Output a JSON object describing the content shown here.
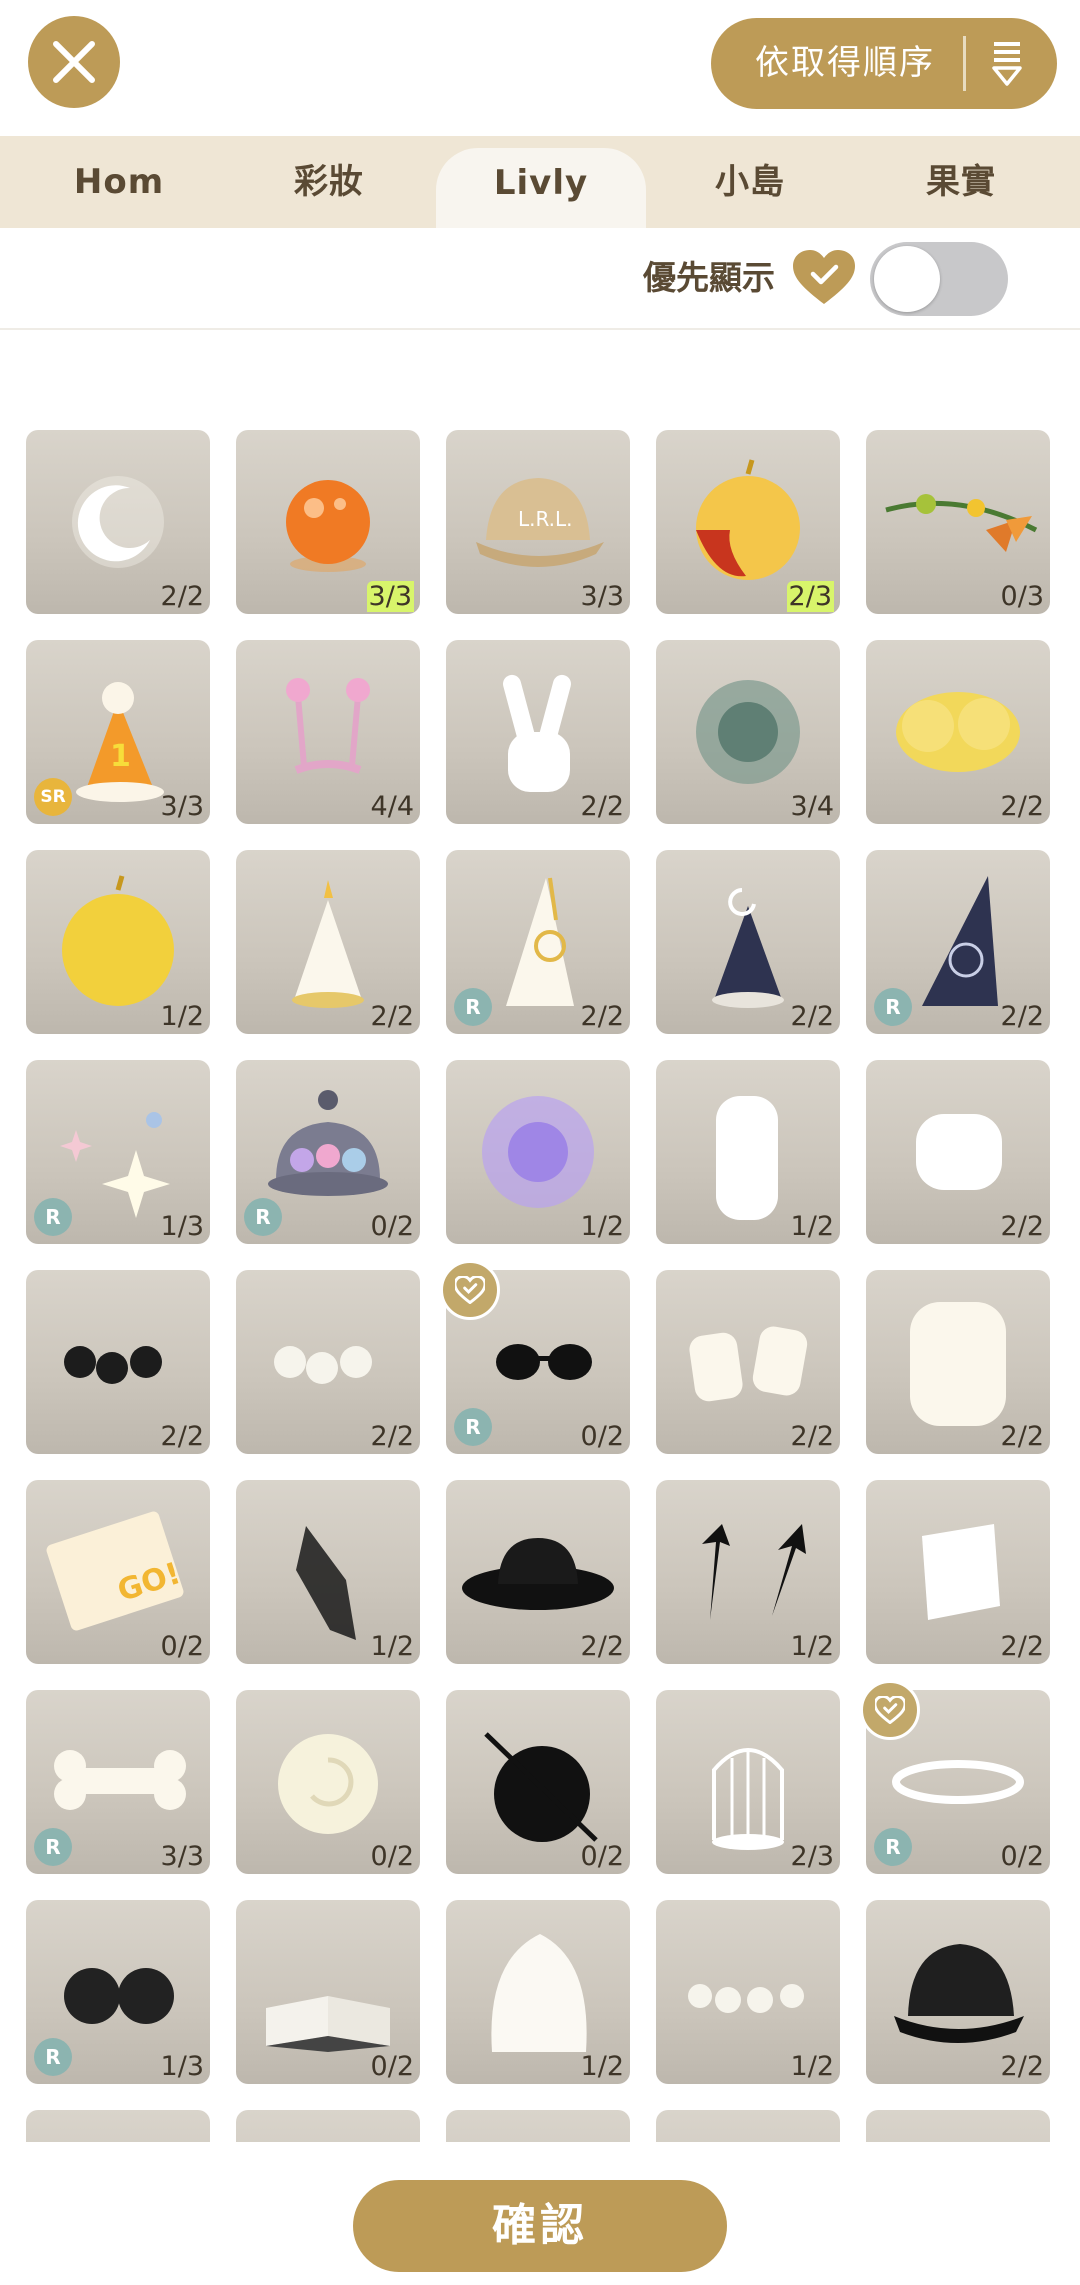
{
  "header": {
    "close_icon": "close-icon",
    "sort_label": "依取得順序",
    "sort_icon": "sort-order-icon"
  },
  "tabs": [
    {
      "label": "Hom",
      "active": false
    },
    {
      "label": "彩妝",
      "active": false
    },
    {
      "label": "Livly",
      "active": true
    },
    {
      "label": "小島",
      "active": false
    },
    {
      "label": "果實",
      "active": false
    }
  ],
  "filter": {
    "label": "優先顯示",
    "icon": "heart-check-icon",
    "toggle_on": false
  },
  "items": [
    {
      "name": "crescent-moon",
      "count": "2/2",
      "icon": "moon"
    },
    {
      "name": "orange-jelly",
      "count": "3/3",
      "icon": "orange-ball",
      "highlight": true
    },
    {
      "name": "lrl-cap",
      "count": "3/3",
      "icon": "beige-cap"
    },
    {
      "name": "candy-apple",
      "count": "2/3",
      "icon": "gold-apple",
      "highlight": true
    },
    {
      "name": "orange-flower-vine",
      "count": "0/3",
      "icon": "vine"
    },
    {
      "name": "party-hat-1",
      "count": "3/3",
      "icon": "party-hat",
      "badge": "SR"
    },
    {
      "name": "pink-star-antenna",
      "count": "4/4",
      "icon": "antenna"
    },
    {
      "name": "peace-glove",
      "count": "2/2",
      "icon": "peace-hand"
    },
    {
      "name": "green-fluff",
      "count": "3/4",
      "icon": "green-burst"
    },
    {
      "name": "gold-cloud",
      "count": "2/2",
      "icon": "gold-cloud"
    },
    {
      "name": "golden-apple",
      "count": "1/2",
      "icon": "golden-apple"
    },
    {
      "name": "white-cone-hat",
      "count": "2/2",
      "icon": "white-cone"
    },
    {
      "name": "sun-cone-hat",
      "count": "2/2",
      "icon": "white-cone-tall",
      "badge": "R"
    },
    {
      "name": "moon-cone-hat",
      "count": "2/2",
      "icon": "navy-cone"
    },
    {
      "name": "navy-tall-cone",
      "count": "2/2",
      "icon": "navy-cone-tall",
      "badge": "R"
    },
    {
      "name": "sparkles",
      "count": "1/3",
      "icon": "sparkles",
      "badge": "R"
    },
    {
      "name": "gem-dome",
      "count": "0/2",
      "icon": "dome",
      "badge": "R"
    },
    {
      "name": "purple-fluff",
      "count": "1/2",
      "icon": "purple-burst"
    },
    {
      "name": "open-glove",
      "count": "1/2",
      "icon": "open-hand"
    },
    {
      "name": "fist-glove",
      "count": "2/2",
      "icon": "fist"
    },
    {
      "name": "black-roses",
      "count": "2/2",
      "icon": "black-roses"
    },
    {
      "name": "white-roses",
      "count": "2/2",
      "icon": "white-roses"
    },
    {
      "name": "round-sunglasses",
      "count": "0/2",
      "icon": "sunglasses",
      "badge": "R",
      "fav": true
    },
    {
      "name": "marshmallows",
      "count": "2/2",
      "icon": "marshmallows"
    },
    {
      "name": "big-marshmallow",
      "count": "2/2",
      "icon": "marshmallow"
    },
    {
      "name": "ticket",
      "count": "0/2",
      "icon": "ticket"
    },
    {
      "name": "shadow-hand",
      "count": "1/2",
      "icon": "shadow-hand"
    },
    {
      "name": "black-hat",
      "count": "2/2",
      "icon": "black-hat"
    },
    {
      "name": "black-arrows",
      "count": "1/2",
      "icon": "arrows"
    },
    {
      "name": "white-patch",
      "count": "2/2",
      "icon": "patch"
    },
    {
      "name": "bone",
      "count": "3/3",
      "icon": "bone",
      "badge": "R"
    },
    {
      "name": "white-rose",
      "count": "0/2",
      "icon": "white-rose"
    },
    {
      "name": "eye-patch",
      "count": "0/2",
      "icon": "eyepatch"
    },
    {
      "name": "birdcage",
      "count": "2/3",
      "icon": "birdcage"
    },
    {
      "name": "halo",
      "count": "0/2",
      "icon": "halo",
      "badge": "R",
      "fav": true
    },
    {
      "name": "dark-glasses",
      "count": "1/3",
      "icon": "glasses",
      "badge": "R"
    },
    {
      "name": "open-book",
      "count": "0/2",
      "icon": "book"
    },
    {
      "name": "cream-swirl",
      "count": "1/2",
      "icon": "cream"
    },
    {
      "name": "rose-garland",
      "count": "1/2",
      "icon": "garland"
    },
    {
      "name": "black-cap",
      "count": "2/2",
      "icon": "black-cap"
    },
    {
      "name": "partial-1",
      "count": "",
      "icon": "none"
    },
    {
      "name": "partial-2",
      "count": "",
      "icon": "none"
    },
    {
      "name": "partial-3",
      "count": "",
      "icon": "none"
    },
    {
      "name": "partial-4",
      "count": "",
      "icon": "none"
    },
    {
      "name": "partial-5",
      "count": "",
      "icon": "none"
    }
  ],
  "footer": {
    "confirm_label": "確認"
  }
}
